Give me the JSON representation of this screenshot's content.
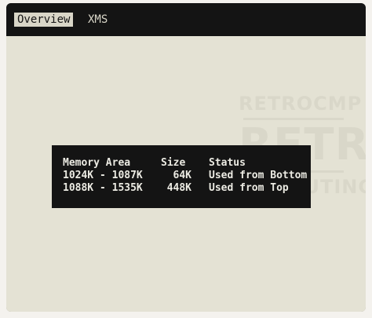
{
  "menu": {
    "tabs": [
      {
        "label": "Overview",
        "active": true
      },
      {
        "label": "XMS",
        "active": false
      }
    ]
  },
  "watermark": {
    "line1": "RETROCMP",
    "line2": "RETRO",
    "line3": "COMPUTING"
  },
  "memory_table": {
    "headers": {
      "area": "Memory Area",
      "size": "Size",
      "status": "Status"
    },
    "rows": [
      {
        "area": "1024K - 1087K",
        "size": "64K",
        "status": "Used from Bottom"
      },
      {
        "area": "1088K - 1535K",
        "size": "448K",
        "status": "Used from Top"
      }
    ]
  },
  "colors": {
    "screen_bg": "#d9d6c8",
    "bar_bg": "#141414",
    "text_light": "#ecebe3"
  }
}
